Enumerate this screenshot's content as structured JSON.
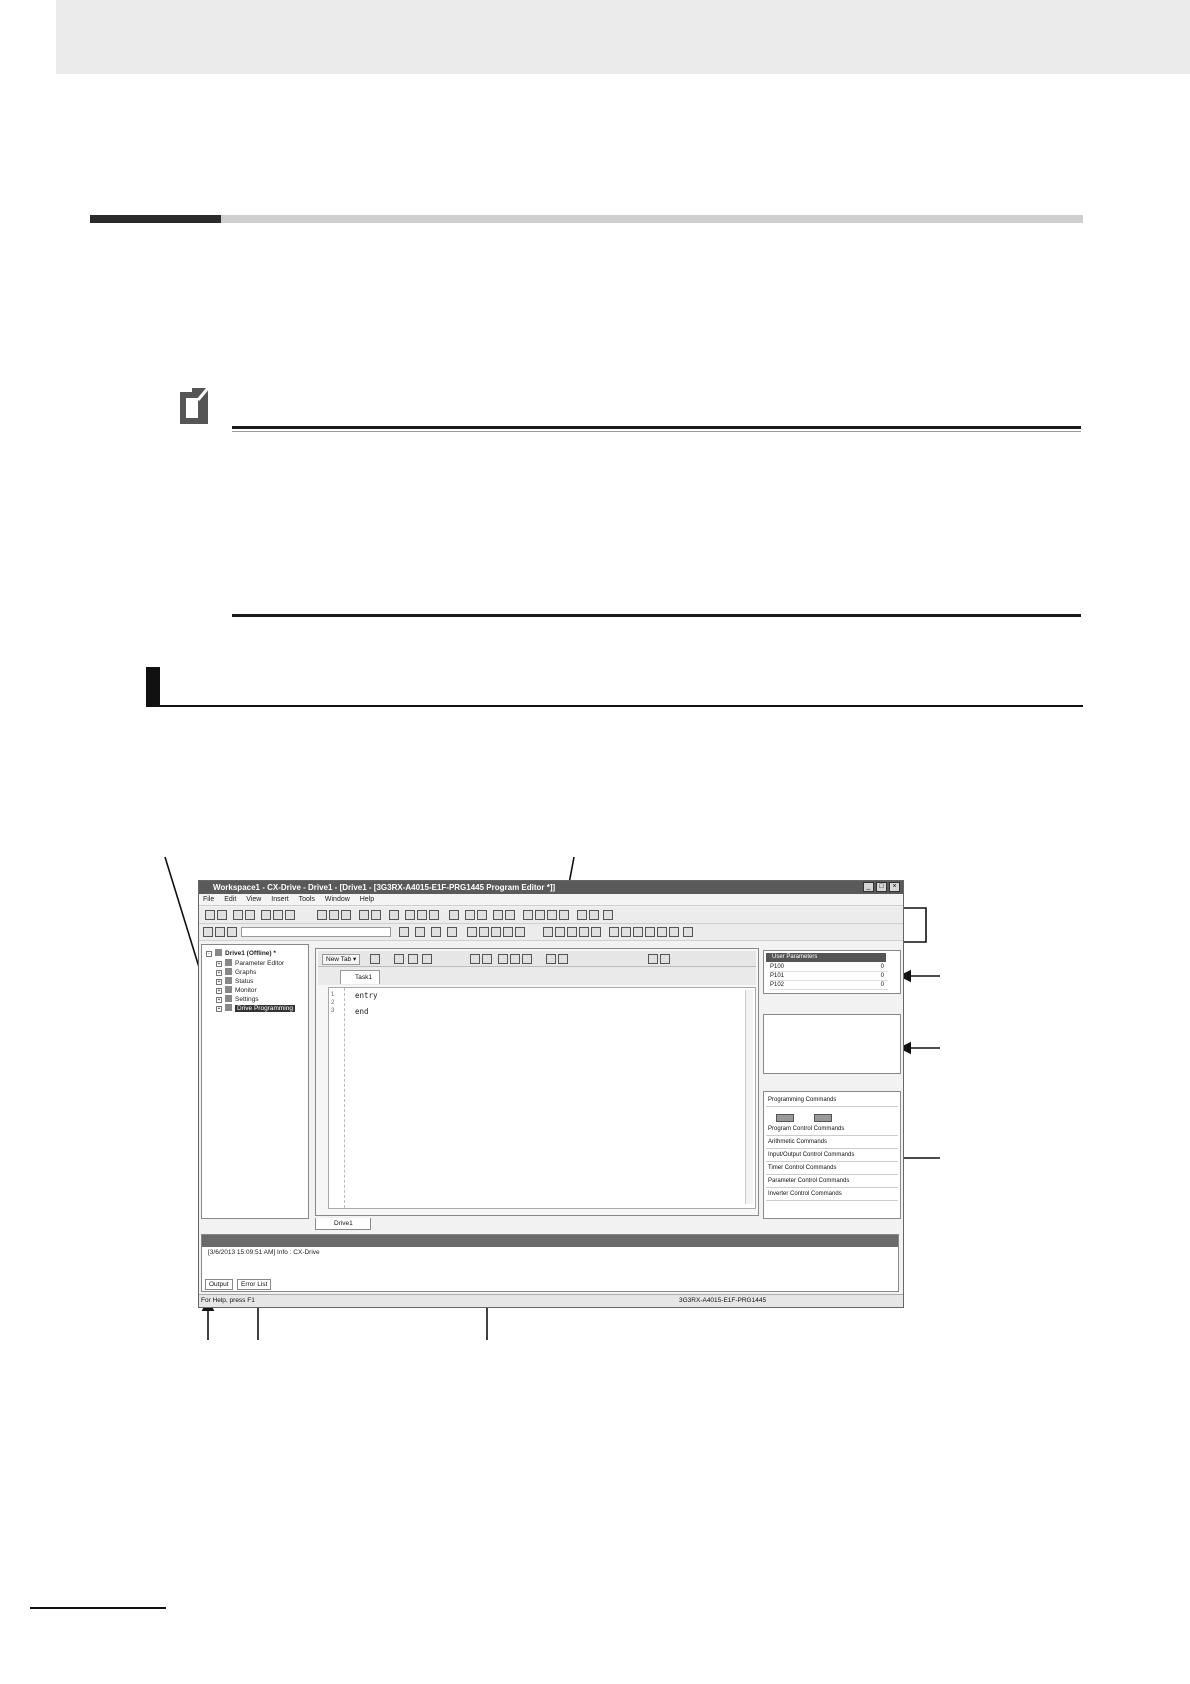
{
  "window": {
    "title": "Workspace1 - CX-Drive - Drive1 - [Drive1 - [3G3RX-A4015-E1F-PRG1445 Program Editor *]]",
    "menu": [
      "File",
      "Edit",
      "View",
      "Insert",
      "Tools",
      "Window",
      "Help"
    ],
    "controls": [
      "_",
      "□",
      "×"
    ]
  },
  "tree": {
    "root": "Drive1 (Offline) *",
    "items": [
      "Parameter Editor",
      "Graphs",
      "Status",
      "Monitor",
      "Settings",
      "Drive Programming"
    ]
  },
  "editor": {
    "new_tab_label": "New Tab",
    "tab_label": "Task1",
    "line_numbers": [
      "1",
      "2",
      "3"
    ],
    "code_lines": [
      "entry",
      "",
      "end"
    ],
    "bottom_tab": "Drive1"
  },
  "user_parameters": {
    "header": "User Parameters",
    "rows": [
      {
        "name": "P100",
        "value": "0"
      },
      {
        "name": "P101",
        "value": "0"
      },
      {
        "name": "P102",
        "value": "0"
      }
    ]
  },
  "commands": {
    "header": "Programming Commands",
    "program_control": "Program Control Commands",
    "items": [
      "Arithmetic Commands",
      "Input/Output Control Commands",
      "Timer Control Commands",
      "Parameter Control Commands",
      "Inverter Control Commands"
    ]
  },
  "output": {
    "text": "[3/6/2013 15:09:51 AM] Info : CX-Drive",
    "tabs": [
      "Output",
      "Error List"
    ]
  },
  "statusbar": {
    "help": "For Help, press F1",
    "model": "3G3RX-A4015-E1F-PRG1445"
  },
  "colors": {
    "header_band": "#ebebeb",
    "rule_dark": "#2b2b2b",
    "rule_light": "#cfcfcf"
  }
}
